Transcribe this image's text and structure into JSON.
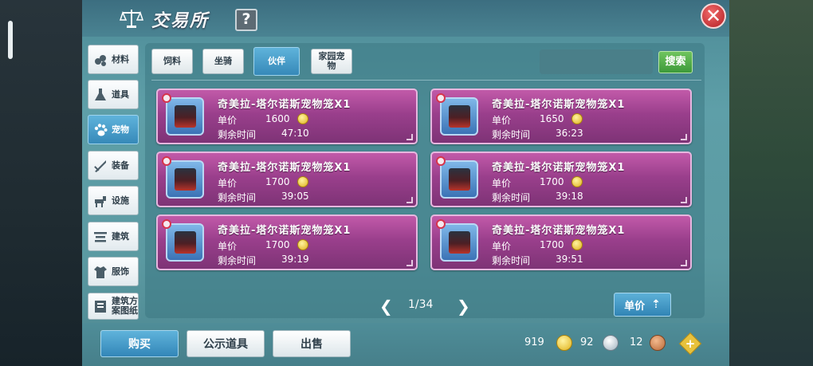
{
  "window": {
    "title": "交易所",
    "help_label": "?",
    "close_label": "✕"
  },
  "sidebar": {
    "items": [
      {
        "label": "材料",
        "icon": "materials-icon",
        "active": false
      },
      {
        "label": "道具",
        "icon": "flask-icon",
        "active": false
      },
      {
        "label": "宠物",
        "icon": "paw-icon",
        "active": true
      },
      {
        "label": "装备",
        "icon": "sword-icon",
        "active": false
      },
      {
        "label": "设施",
        "icon": "horse-icon",
        "active": false
      },
      {
        "label": "建筑",
        "icon": "building-icon",
        "active": false
      },
      {
        "label": "服饰",
        "icon": "clothing-icon",
        "active": false
      },
      {
        "label": "建筑方案图纸",
        "icon": "blueprint-icon",
        "active": false
      }
    ]
  },
  "tabs": [
    {
      "label": "饲料",
      "active": false
    },
    {
      "label": "坐骑",
      "active": false
    },
    {
      "label": "伙伴",
      "active": true
    },
    {
      "label": "家园宠物",
      "active": false
    }
  ],
  "search": {
    "value": "",
    "button_label": "搜索"
  },
  "listings": [
    {
      "name": "奇美拉-塔尔诺斯宠物笼X1",
      "price_label": "单价",
      "price": "1600",
      "time_label": "剩余时间",
      "time": "47:10"
    },
    {
      "name": "奇美拉-塔尔诺斯宠物笼X1",
      "price_label": "单价",
      "price": "1650",
      "time_label": "剩余时间",
      "time": "36:23"
    },
    {
      "name": "奇美拉-塔尔诺斯宠物笼X1",
      "price_label": "单价",
      "price": "1700",
      "time_label": "剩余时间",
      "time": "39:05"
    },
    {
      "name": "奇美拉-塔尔诺斯宠物笼X1",
      "price_label": "单价",
      "price": "1700",
      "time_label": "剩余时间",
      "time": "39:18"
    },
    {
      "name": "奇美拉-塔尔诺斯宠物笼X1",
      "price_label": "单价",
      "price": "1700",
      "time_label": "剩余时间",
      "time": "39:19"
    },
    {
      "name": "奇美拉-塔尔诺斯宠物笼X1",
      "price_label": "单价",
      "price": "1700",
      "time_label": "剩余时间",
      "time": "39:51"
    }
  ],
  "pager": {
    "prev": "❮",
    "next": "❯",
    "text": "1/34"
  },
  "sort": {
    "label": "单价",
    "arrow": "⇡"
  },
  "bottom": {
    "buy_label": "购买",
    "public_label": "公示道具",
    "sell_label": "出售"
  },
  "currency": {
    "gold": "919",
    "silver": "92",
    "bronze": "12",
    "add_label": "+"
  },
  "colors": {
    "accent_blue": "#3689b9",
    "card_purple": "#9a3f8c",
    "search_green": "#3d9a3a",
    "close_red": "#b31e23"
  }
}
